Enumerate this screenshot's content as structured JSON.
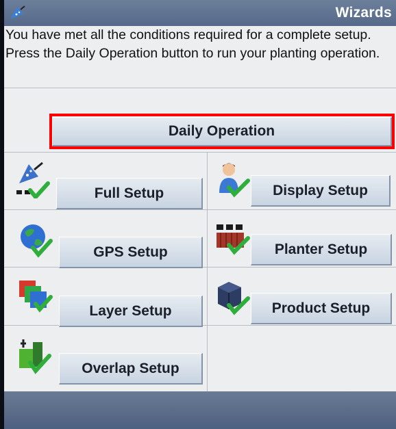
{
  "window": {
    "title": "Wizards"
  },
  "message": "You have met all the conditions required for a complete setup. Press the Daily Operation button to run your planting operation.",
  "primary_button": {
    "label": "Daily Operation",
    "highlight_color": "#ff0000"
  },
  "wizards": [
    {
      "label": "Full Setup",
      "icon": "full-setup-icon"
    },
    {
      "label": "Display Setup",
      "icon": "display-setup-icon"
    },
    {
      "label": "GPS Setup",
      "icon": "gps-setup-icon"
    },
    {
      "label": "Planter Setup",
      "icon": "planter-setup-icon"
    },
    {
      "label": "Layer Setup",
      "icon": "layer-setup-icon"
    },
    {
      "label": "Product Setup",
      "icon": "product-setup-icon"
    },
    {
      "label": "Overlap Setup",
      "icon": "overlap-setup-icon"
    }
  ],
  "colors": {
    "titlebar": "#5f7290",
    "button_face": "#d3dce8",
    "background": "#eceef0",
    "checkmark": "#2fae3c"
  }
}
